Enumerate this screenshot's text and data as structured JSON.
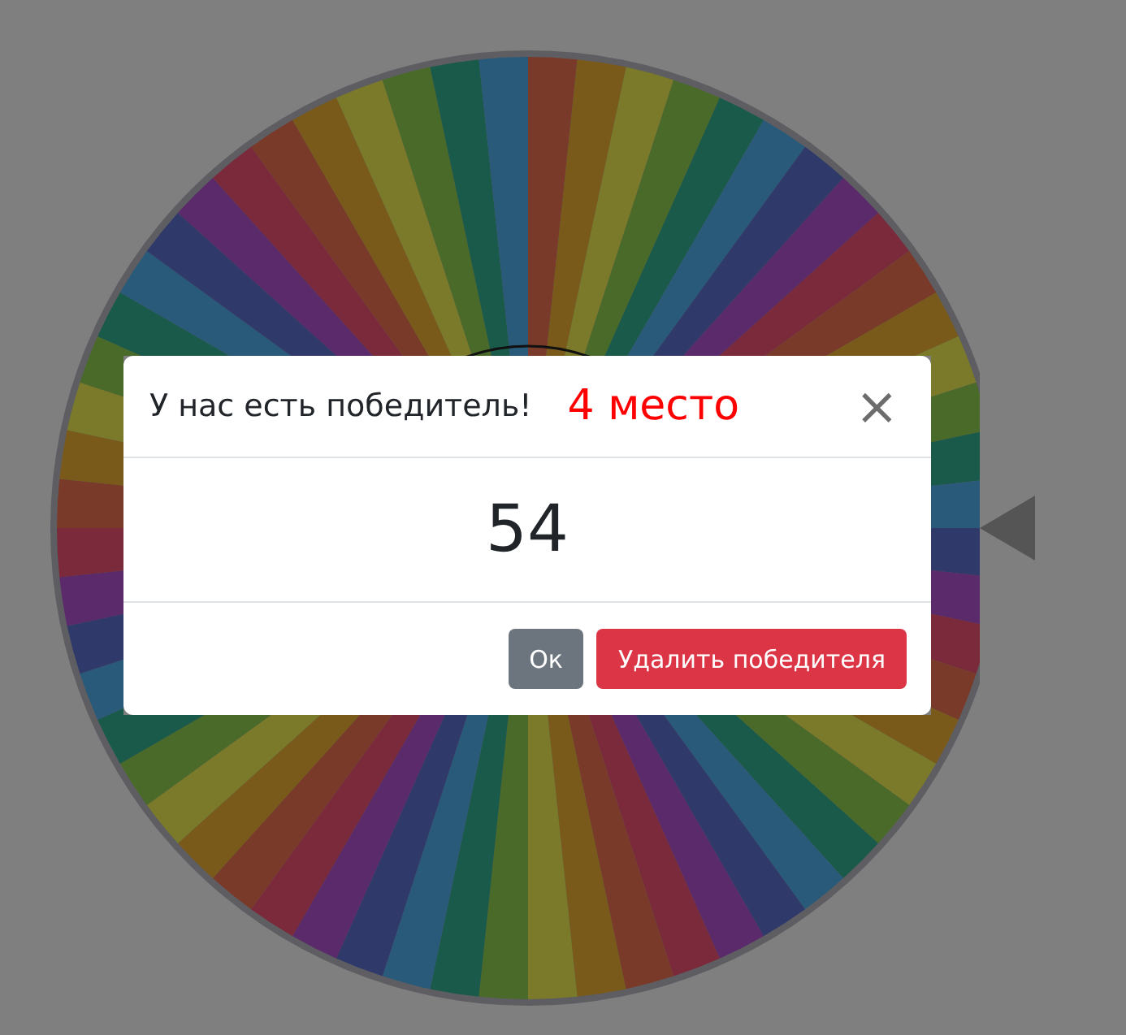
{
  "dialog": {
    "title": "У нас есть победитель!",
    "place": "4 место",
    "close_icon": "×",
    "winner": "54",
    "buttons": [
      {
        "label": "Ок",
        "kind": "secondary"
      },
      {
        "label": "Удалить победителя",
        "kind": "danger"
      }
    ]
  }
}
